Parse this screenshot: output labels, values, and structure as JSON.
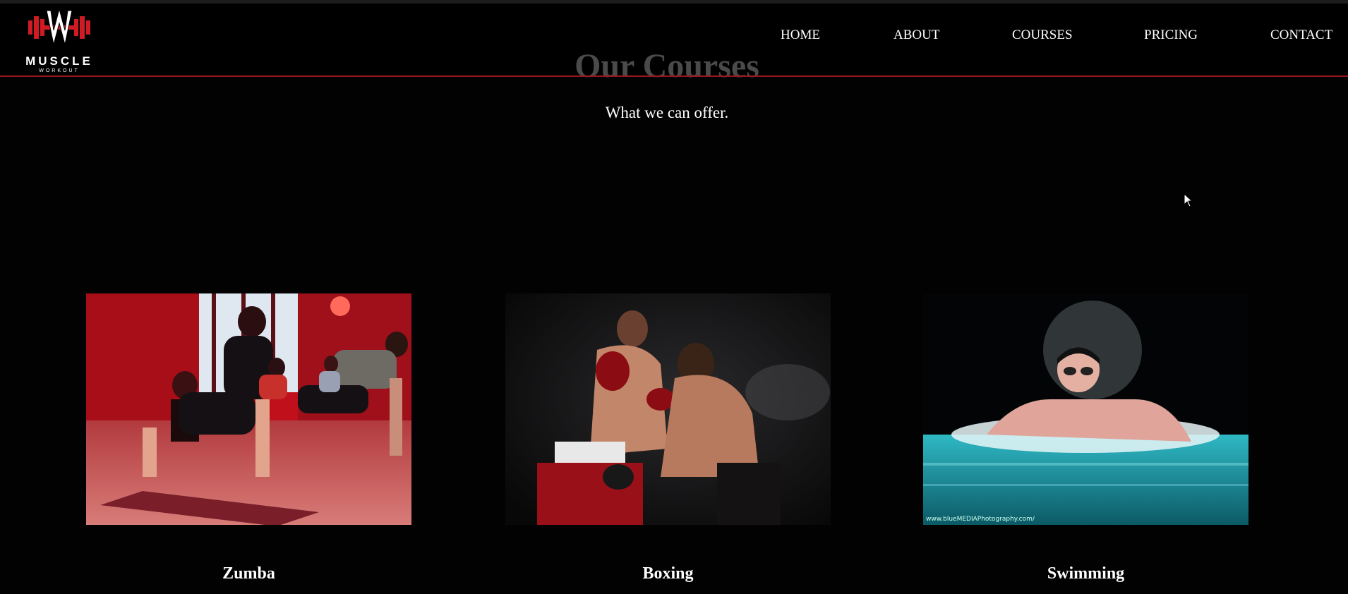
{
  "logo": {
    "name": "MUSCLE",
    "tagline": "WORKOUT"
  },
  "nav": {
    "items": [
      {
        "label": "HOME"
      },
      {
        "label": "ABOUT"
      },
      {
        "label": "COURSES"
      },
      {
        "label": "PRICING"
      },
      {
        "label": "CONTACT"
      }
    ]
  },
  "section": {
    "title": "Our Courses",
    "subtitle": "What we can offer."
  },
  "courses": [
    {
      "title": "Zumba"
    },
    {
      "title": "Boxing"
    },
    {
      "title": "Swimming"
    }
  ],
  "colors": {
    "accent": "#9b1520",
    "background": "#020203",
    "title_gray": "#4a4a4a"
  },
  "image_captions": {
    "swimming_credit": "www.blueMEDIAPhotography.com/"
  }
}
